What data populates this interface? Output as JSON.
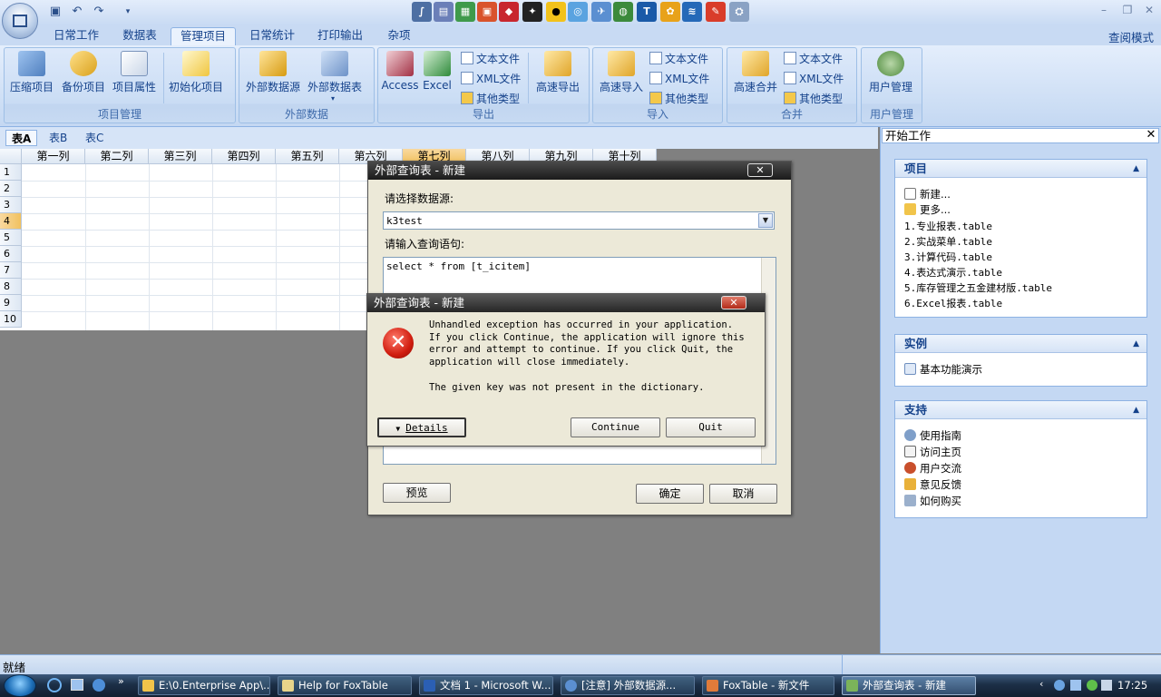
{
  "ribbon_tabs": [
    "日常工作",
    "数据表",
    "管理项目",
    "日常统计",
    "打印输出",
    "杂项"
  ],
  "read_mode": "查阅模式",
  "groups": {
    "project": {
      "title": "项目管理",
      "buttons": [
        "压缩项目",
        "备份项目",
        "项目属性",
        "初始化项目"
      ]
    },
    "external": {
      "title": "外部数据",
      "buttons": [
        "外部数据源",
        "外部数据表"
      ]
    },
    "export": {
      "title": "导出",
      "buttons": [
        "Access",
        "Excel",
        "高速导出"
      ],
      "small": [
        "文本文件",
        "XML文件",
        "其他类型"
      ]
    },
    "import": {
      "title": "导入",
      "buttons": [
        "高速导入"
      ],
      "small": [
        "文本文件",
        "XML文件",
        "其他类型"
      ]
    },
    "merge": {
      "title": "合并",
      "buttons": [
        "高速合并"
      ],
      "small": [
        "文本文件",
        "XML文件",
        "其他类型"
      ]
    },
    "users": {
      "title": "用户管理",
      "buttons": [
        "用户管理"
      ]
    }
  },
  "sheet_tabs": [
    "表A",
    "表B",
    "表C"
  ],
  "columns": [
    "第一列",
    "第二列",
    "第三列",
    "第四列",
    "第五列",
    "第六列",
    "第七列",
    "第八列",
    "第九列",
    "第十列"
  ],
  "rows": [
    "1",
    "2",
    "3",
    "4",
    "5",
    "6",
    "7",
    "8",
    "9",
    "10"
  ],
  "task_pane": {
    "title": "开始工作",
    "projects": {
      "title": "项目",
      "items": [
        "新建...",
        "更多...",
        "1.专业报表.table",
        "2.实战菜单.table",
        "3.计算代码.table",
        "4.表达式演示.table",
        "5.库存管理之五金建材版.table",
        "6.Excel报表.table"
      ]
    },
    "examples": {
      "title": "实例",
      "items": [
        "基本功能演示"
      ]
    },
    "support": {
      "title": "支持",
      "items": [
        "使用指南",
        "访问主页",
        "用户交流",
        "意见反馈",
        "如何购买"
      ]
    }
  },
  "query_dialog": {
    "title": "外部查询表 - 新建",
    "source_label": "请选择数据源:",
    "source_value": "k3test",
    "query_label": "请输入查询语句:",
    "query_value": "select * from [t_icitem]",
    "preview": "预览",
    "ok": "确定",
    "cancel": "取消"
  },
  "error_dialog": {
    "title": "外部查询表 - 新建",
    "message": "Unhandled exception has occurred in your application. If you click Continue, the application will ignore this error and attempt to continue. If you click Quit, the application will close immediately.",
    "detail": "The given key was not present in the dictionary.",
    "details_btn": "Details",
    "continue_btn": "Continue",
    "quit_btn": "Quit"
  },
  "status": "就绪",
  "taskbar": {
    "tasks": [
      "E:\\0.Enterprise App\\...",
      "Help for FoxTable",
      "文档 1 - Microsoft W...",
      "[注意] 外部数据源...",
      "FoxTable - 新文件",
      "外部查询表 - 新建"
    ],
    "clock": "17:25"
  }
}
